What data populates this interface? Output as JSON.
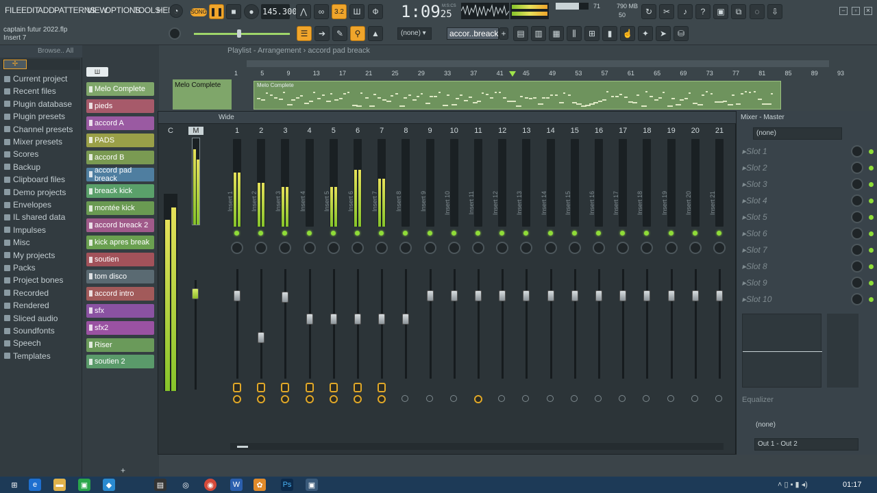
{
  "menu": [
    "FILE",
    "EDIT",
    "ADD",
    "PATTERNS",
    "VIEW",
    "OPTIONS",
    "TOOLS",
    "HELP"
  ],
  "transport": {
    "mode": "SONG",
    "tempo": "145.300",
    "time": "1:09",
    "time_small": "25",
    "time_unit": "M:S:CS",
    "pattern_step": "3.2",
    "cpu": "71",
    "mem": "790 MB",
    "poly": "50"
  },
  "project": {
    "filename": "captain futur 2022.flp",
    "hint": "Insert 7"
  },
  "preset_box": "(none)",
  "pattern_box": "accor..breack",
  "browser": {
    "title": "Browse.. All",
    "items": [
      "Current project",
      "Recent files",
      "Plugin database",
      "Plugin presets",
      "Channel presets",
      "Mixer presets",
      "Scores",
      "Backup",
      "Clipboard files",
      "Demo projects",
      "Envelopes",
      "IL shared data",
      "Impulses",
      "Misc",
      "My projects",
      "Packs",
      "Project bones",
      "Recorded",
      "Rendered",
      "Sliced audio",
      "Soundfonts",
      "Speech",
      "Templates"
    ]
  },
  "channels": [
    {
      "name": "Melo Complete",
      "color": "#7fa66a"
    },
    {
      "name": "pieds",
      "color": "#a75a6a"
    },
    {
      "name": "accord A",
      "color": "#9a5aa2"
    },
    {
      "name": "PADS",
      "color": "#9aa048"
    },
    {
      "name": "accord B",
      "color": "#7a9a52"
    },
    {
      "name": "accord pad breack",
      "color": "#4f7ea0"
    },
    {
      "name": "breack kick",
      "color": "#5aa06a"
    },
    {
      "name": "montée kick",
      "color": "#6a9a52"
    },
    {
      "name": "accord breack 2",
      "color": "#a05a8a"
    },
    {
      "name": "kick apres break",
      "color": "#6aa050"
    },
    {
      "name": "soutien",
      "color": "#a2525a"
    },
    {
      "name": "tom disco",
      "color": "#5a6a72"
    },
    {
      "name": "accord intro",
      "color": "#a25a5a"
    },
    {
      "name": "sfx",
      "color": "#8a52a2"
    },
    {
      "name": "sfx2",
      "color": "#9a52a2"
    },
    {
      "name": "Riser",
      "color": "#6a9a5a"
    },
    {
      "name": "soutien 2",
      "color": "#5a9a6a"
    }
  ],
  "playlist": {
    "title": "Playlist - Arrangement",
    "pattern": "accord pad breack",
    "track_name": "Melo Complete",
    "clip_name": "Melo Complete",
    "bars": [
      "1",
      "5",
      "9",
      "13",
      "17",
      "21",
      "25",
      "29",
      "33",
      "37",
      "41",
      "45",
      "49",
      "53",
      "57",
      "61",
      "65",
      "69",
      "73",
      "77",
      "81",
      "85",
      "89",
      "93"
    ]
  },
  "mixer": {
    "view": "Wide",
    "strips": [
      {
        "num": "1",
        "label": "Insert 1",
        "level": 0.62,
        "fader": 0.93
      },
      {
        "num": "2",
        "label": "Insert 2",
        "level": 0.5,
        "fader": 0.55
      },
      {
        "num": "3",
        "label": "Insert 3",
        "level": 0.45,
        "fader": 0.92
      },
      {
        "num": "4",
        "label": "Insert 4",
        "level": 0.0,
        "fader": 0.72
      },
      {
        "num": "5",
        "label": "Insert 5",
        "level": 0.45,
        "fader": 0.72
      },
      {
        "num": "6",
        "label": "Insert 6",
        "level": 0.65,
        "fader": 0.72
      },
      {
        "num": "7",
        "label": "Insert 7",
        "level": 0.55,
        "fader": 0.72
      },
      {
        "num": "8",
        "label": "Insert 8",
        "level": 0.0,
        "fader": 0.72
      },
      {
        "num": "9",
        "label": "Insert 9",
        "level": 0.0,
        "fader": 0.93
      },
      {
        "num": "10",
        "label": "Insert 10",
        "level": 0.0,
        "fader": 0.93
      },
      {
        "num": "11",
        "label": "Insert 11",
        "level": 0.0,
        "fader": 0.93
      },
      {
        "num": "12",
        "label": "Insert 12",
        "level": 0.0,
        "fader": 0.93
      },
      {
        "num": "13",
        "label": "Insert 13",
        "level": 0.0,
        "fader": 0.93
      },
      {
        "num": "14",
        "label": "Insert 14",
        "level": 0.0,
        "fader": 0.93
      },
      {
        "num": "15",
        "label": "Insert 15",
        "level": 0.0,
        "fader": 0.93
      },
      {
        "num": "16",
        "label": "Insert 16",
        "level": 0.0,
        "fader": 0.93
      },
      {
        "num": "17",
        "label": "Insert 17",
        "level": 0.0,
        "fader": 0.93
      },
      {
        "num": "18",
        "label": "Insert 18",
        "level": 0.0,
        "fader": 0.93
      },
      {
        "num": "19",
        "label": "Insert 19",
        "level": 0.0,
        "fader": 0.93
      },
      {
        "num": "20",
        "label": "Insert 20",
        "level": 0.0,
        "fader": 0.93
      },
      {
        "num": "21",
        "label": "Insert 21",
        "level": 0.0,
        "fader": 0.93
      }
    ]
  },
  "master": {
    "title": "Mixer - Master",
    "preset": "(none)",
    "slots": [
      "Slot 1",
      "Slot 2",
      "Slot 3",
      "Slot 4",
      "Slot 5",
      "Slot 6",
      "Slot 7",
      "Slot 8",
      "Slot 9",
      "Slot 10"
    ],
    "eq_label": "Equalizer",
    "bottom_preset": "(none)",
    "output": "Out 1 - Out 2"
  },
  "taskbar": {
    "clock": "01:17"
  },
  "colors": {
    "accent": "#f0a52b",
    "meter": "#8fdc38"
  }
}
